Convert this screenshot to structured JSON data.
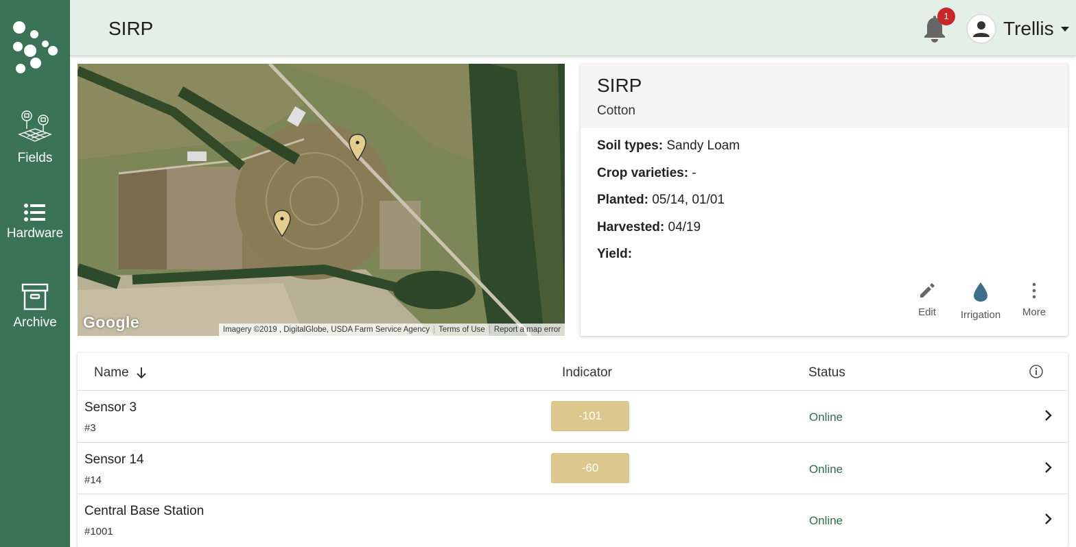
{
  "sidebar": {
    "items": [
      {
        "label": "Fields",
        "icon": "fields-icon"
      },
      {
        "label": "Hardware",
        "icon": "list-icon"
      },
      {
        "label": "Archive",
        "icon": "archive-box-icon"
      }
    ]
  },
  "header": {
    "title": "SIRP",
    "notifications_count": "1",
    "user_name": "Trellis"
  },
  "map": {
    "logo_text": "Google",
    "attribution": "Imagery ©2019 , DigitalGlobe, USDA Farm Service Agency",
    "terms": "Terms of Use",
    "report": "Report a map error"
  },
  "field": {
    "name": "SIRP",
    "crop": "Cotton",
    "soil_label": "Soil types:",
    "soil_value": " Sandy Loam",
    "varieties_label": "Crop varieties:",
    "varieties_value": " -",
    "planted_label": "Planted:",
    "planted_value": " 05/14, 01/01",
    "harvested_label": "Harvested:",
    "harvested_value": " 04/19",
    "yield_label": "Yield:",
    "yield_value": ""
  },
  "actions": {
    "edit": "Edit",
    "irrigation": "Irrigation",
    "more": "More"
  },
  "table": {
    "headers": {
      "name": "Name",
      "indicator": "Indicator",
      "status": "Status"
    },
    "rows": [
      {
        "name": "Sensor 3",
        "id": "#3",
        "indicator": "-101",
        "status": "Online"
      },
      {
        "name": "Sensor 14",
        "id": "#14",
        "indicator": "-60",
        "status": "Online"
      },
      {
        "name": "Central Base Station",
        "id": "#1001",
        "indicator": "",
        "status": "Online"
      }
    ]
  },
  "colors": {
    "sidebar": "#3b7356",
    "header": "#e4efe8",
    "indicator": "#dcc88c",
    "status_online": "#2e6e4a",
    "badge": "#c62828",
    "irrigation": "#3d6e8a"
  }
}
